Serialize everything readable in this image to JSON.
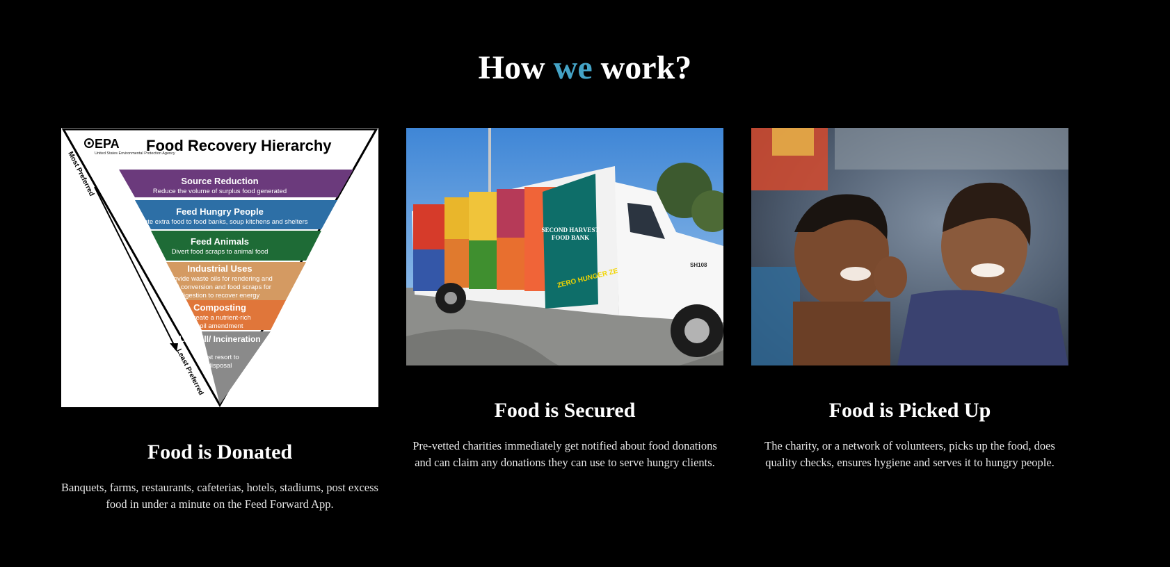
{
  "section": {
    "heading_pre": "How",
    "heading_accent": "we",
    "heading_post": "work?"
  },
  "cards": [
    {
      "title": "Food is Donated",
      "description": "Banquets, farms, restaurants, cafeterias, hotels, stadiums, post excess food in under a minute on the Feed Forward App.",
      "image": {
        "kind": "epa-food-recovery-hierarchy",
        "logo": "EPA",
        "logo_sub": "United States Environmental Protection Agency",
        "title": "Food Recovery Hierarchy",
        "most_label": "Most Preferred",
        "least_label": "Least Preferred",
        "tiers": [
          {
            "name": "Source Reduction",
            "lines": [
              "Reduce the volume of surplus food generated"
            ],
            "color": "#6b3a7c"
          },
          {
            "name": "Feed Hungry People",
            "lines": [
              "Donate extra food to food banks, soup kitchens and shelters"
            ],
            "color": "#2d6fa6"
          },
          {
            "name": "Feed Animals",
            "lines": [
              "Divert food scraps to animal food"
            ],
            "color": "#1e6b36"
          },
          {
            "name": "Industrial Uses",
            "lines": [
              "Provide waste oils for rendering and",
              "fuel conversion and food scraps for",
              "digestion to recover energy"
            ],
            "color": "#d49a62"
          },
          {
            "name": "Composting",
            "lines": [
              "Create a nutrient-rich",
              "soil amendment"
            ],
            "color": "#e0763a"
          },
          {
            "name": "Landfill/ Incineration",
            "lines": [
              "Last resort to",
              "disposal"
            ],
            "color": "#8a8a8a"
          }
        ]
      }
    },
    {
      "title": "Food is Secured",
      "description": "Pre-vetted charities immediately get notified about food donations and can claim any donations they can use to serve hungry clients.",
      "image": {
        "kind": "photo-food-bank-truck",
        "truck_logo_line1": "SECOND HARVEST",
        "truck_logo_line2": "FOOD BANK",
        "truck_slogan": "ZERO HUNGER ZERO WASTE",
        "truck_number": "SH108"
      }
    },
    {
      "title": "Food is Picked Up",
      "description": "The charity, or a network of volunteers, picks up the food, does quality checks, ensures hygiene and serves it to hungry people.",
      "image": {
        "kind": "photo-smiling-children"
      }
    }
  ]
}
